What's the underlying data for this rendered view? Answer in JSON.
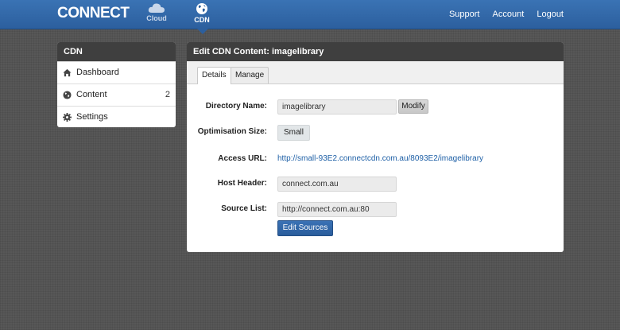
{
  "header": {
    "logo": "CONNECT",
    "tabs": [
      {
        "label": "Cloud",
        "icon": "cloud-icon"
      },
      {
        "label": "CDN",
        "icon": "globe-icon"
      }
    ],
    "links": [
      "Support",
      "Account",
      "Logout"
    ]
  },
  "sidebar": {
    "title": "CDN",
    "items": [
      {
        "label": "Dashboard",
        "icon": "home-icon",
        "count": ""
      },
      {
        "label": "Content",
        "icon": "globe-icon",
        "count": "2"
      },
      {
        "label": "Settings",
        "icon": "gear-icon",
        "count": ""
      }
    ]
  },
  "panel": {
    "title": "Edit CDN Content: imagelibrary",
    "tabs": [
      "Details",
      "Manage"
    ],
    "fields": {
      "directory_name": {
        "label": "Directory Name:",
        "value": "imagelibrary",
        "button": "Modify"
      },
      "optimisation_size": {
        "label": "Optimisation Size:",
        "value": "Small"
      },
      "access_url": {
        "label": "Access URL:",
        "value": "http://small-93E2.connectcdn.com.au/8093E2/imagelibrary"
      },
      "host_header": {
        "label": "Host Header:",
        "value": "connect.com.au"
      },
      "source_list": {
        "label": "Source List:",
        "value": "http://connect.com.au:80"
      }
    },
    "edit_sources_label": "Edit Sources"
  },
  "colors": {
    "topbar": "#2c5f9e",
    "panel_header": "#3f3f3f",
    "link": "#1d5fa6",
    "primary_button": "#2a5d9c"
  }
}
